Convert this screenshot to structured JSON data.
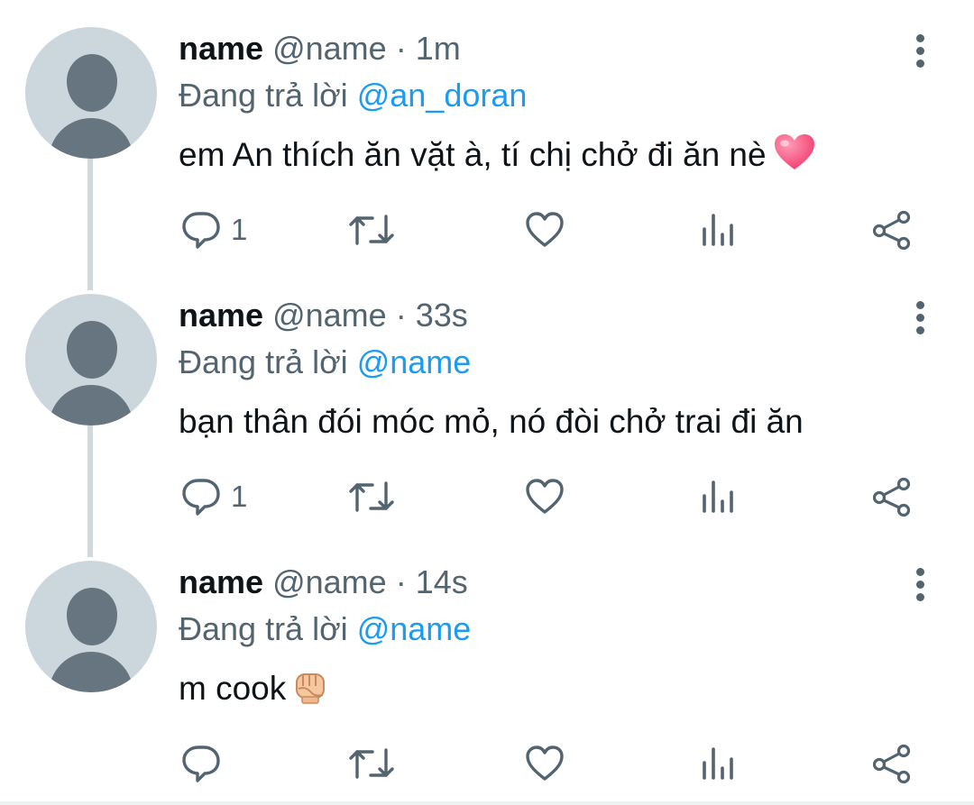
{
  "tweets": [
    {
      "display_name": "name",
      "handle": "@name",
      "separator": "·",
      "time": "1m",
      "replying_prefix": "Đang trả lời",
      "replying_to": "@an_doran",
      "text": "em An thích ăn vặt à, tí chị chở đi ăn nè",
      "text_emoji": "heart",
      "reply_count": "1"
    },
    {
      "display_name": "name",
      "handle": "@name",
      "separator": "·",
      "time": "33s",
      "replying_prefix": "Đang trả lời",
      "replying_to": "@name",
      "text": "bạn thân đói móc mỏ, nó đòi chở trai đi ăn",
      "text_emoji": "",
      "reply_count": "1"
    },
    {
      "display_name": "name",
      "handle": "@name",
      "separator": "·",
      "time": "14s",
      "replying_prefix": "Đang trả lời",
      "replying_to": "@name",
      "text": "m cook",
      "text_emoji": "oncoming-fist",
      "reply_count": ""
    }
  ],
  "icons": {
    "more": "vertical-ellipsis-icon",
    "reply": "reply-bubble-icon",
    "retweet": "retweet-icon",
    "like": "heart-outline-icon",
    "stats": "bar-chart-icon",
    "share": "share-icon"
  },
  "colors": {
    "text": "#0f1419",
    "secondary": "#536471",
    "link": "#1d9bf0",
    "avatar_bg": "#ccd6dd",
    "avatar_fg": "#66757f",
    "thread_line": "#cfd9de"
  }
}
